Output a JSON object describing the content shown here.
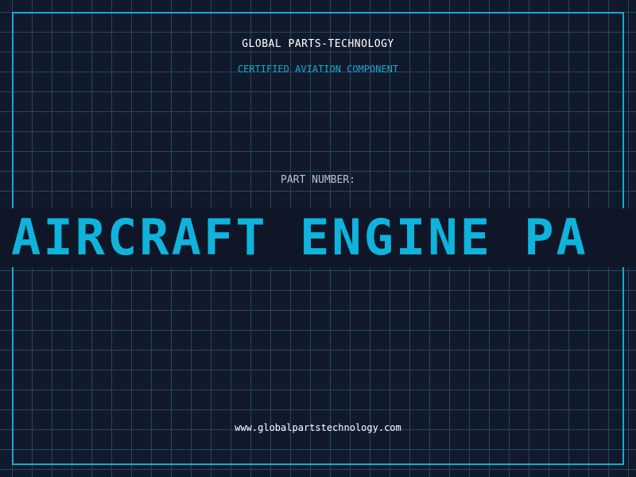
{
  "header": {
    "company": "GLOBAL PARTS-TECHNOLOGY",
    "subtitle": "CERTIFIED AVIATION COMPONENT"
  },
  "part": {
    "label": "PART NUMBER:",
    "banner_text": "AIRCRAFT ENGINE PA"
  },
  "footer": {
    "website": "www.globalpartstechnology.com"
  },
  "colors": {
    "background": "#111a2c",
    "grid": "#1f4a5c",
    "accent": "#1ba8d0",
    "banner_text": "#0fb3db"
  }
}
